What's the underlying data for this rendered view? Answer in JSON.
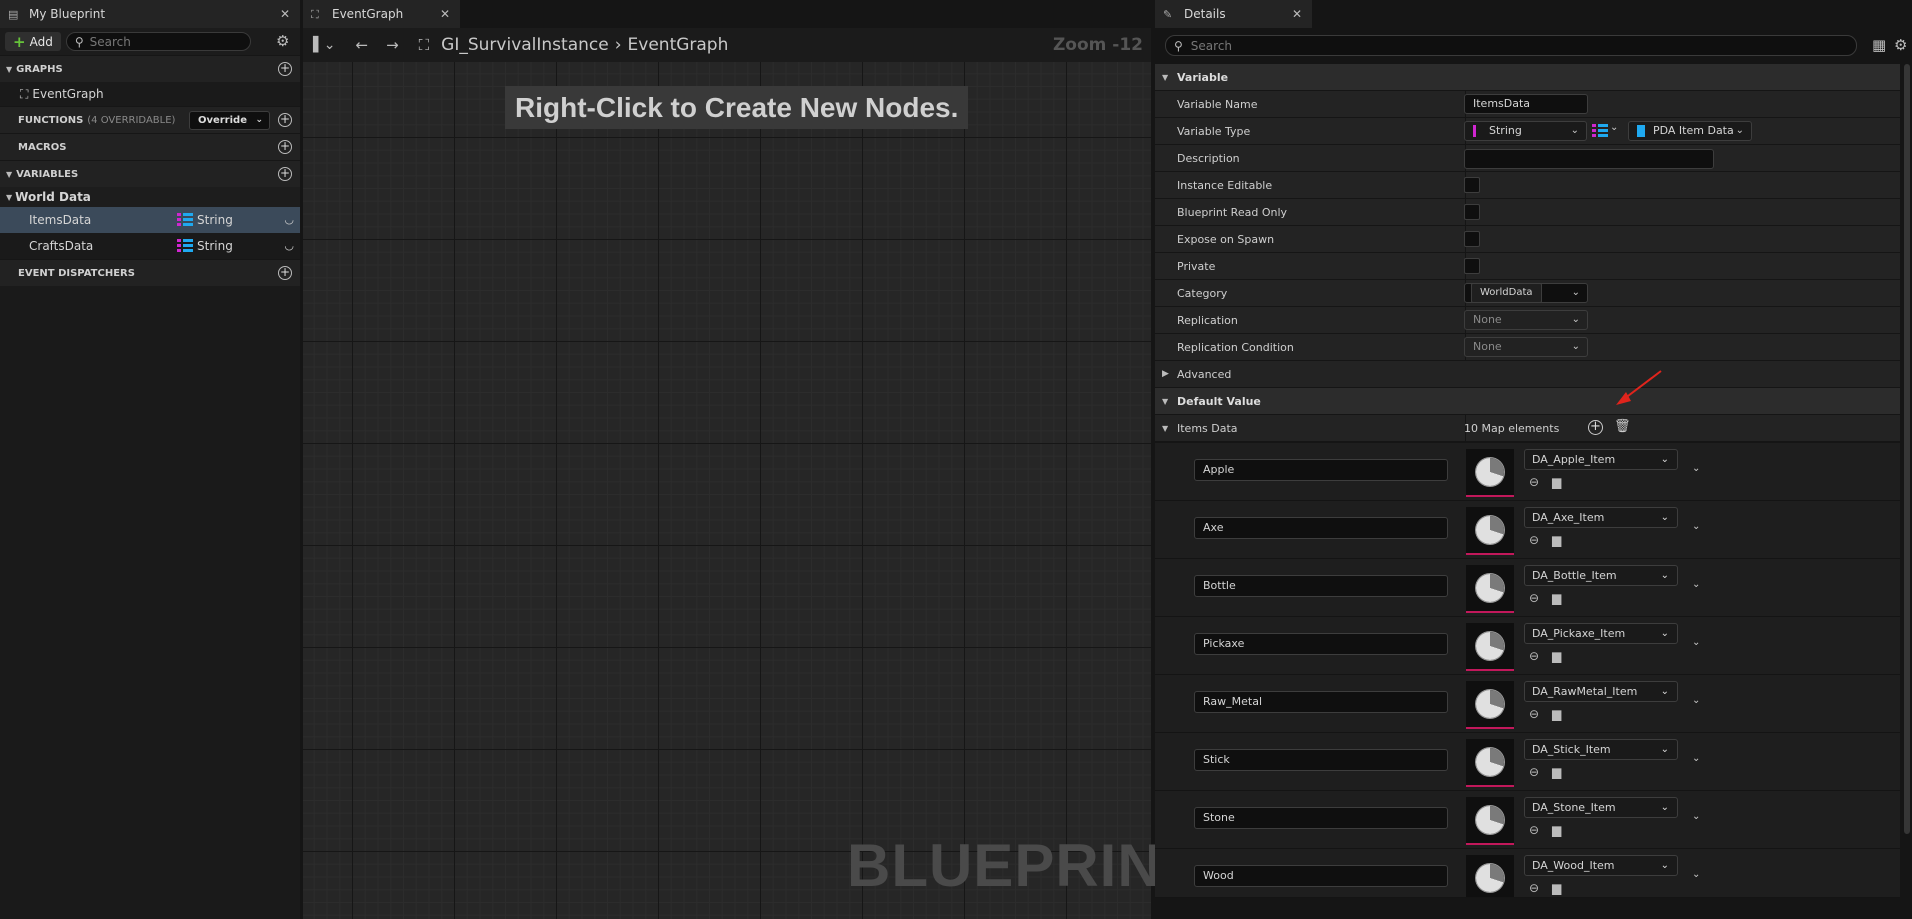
{
  "tabs": {
    "my_blueprint": "My Blueprint",
    "event_graph": "EventGraph",
    "details": "Details"
  },
  "left": {
    "add_label": "Add",
    "search_placeholder": "Search",
    "graphs_header": "GRAPHS",
    "graph_item": "EventGraph",
    "functions_header": "FUNCTIONS",
    "functions_sub": "(4 OVERRIDABLE)",
    "override_label": "Override",
    "macros_header": "MACROS",
    "variables_header": "VARIABLES",
    "category_name": "World Data",
    "variables": [
      {
        "name": "ItemsData",
        "type": "String"
      },
      {
        "name": "CraftsData",
        "type": "String"
      }
    ],
    "dispatchers_header": "EVENT DISPATCHERS"
  },
  "graph": {
    "breadcrumb_root": "GI_SurvivalInstance",
    "breadcrumb_leaf": "EventGraph",
    "zoom": "Zoom -12",
    "hint": "Right-Click to Create New Nodes.",
    "watermark": "BLUEPRINT"
  },
  "details": {
    "search_placeholder": "Search",
    "variable_section": "Variable",
    "props": {
      "variable_name_label": "Variable Name",
      "variable_name_value": "ItemsData",
      "variable_type_label": "Variable Type",
      "key_type": "String",
      "value_type": "PDA Item Data",
      "description_label": "Description",
      "instance_editable_label": "Instance Editable",
      "bp_read_only_label": "Blueprint Read Only",
      "expose_on_spawn_label": "Expose on Spawn",
      "private_label": "Private",
      "category_label": "Category",
      "category_value": "WorldData",
      "replication_label": "Replication",
      "replication_value": "None",
      "replication_condition_label": "Replication Condition",
      "replication_condition_value": "None",
      "advanced_label": "Advanced"
    },
    "default_value_section": "Default Value",
    "map_label": "Items Data",
    "map_count": "10 Map elements",
    "elements": [
      {
        "key": "Apple",
        "asset": "DA_Apple_Item"
      },
      {
        "key": "Axe",
        "asset": "DA_Axe_Item"
      },
      {
        "key": "Bottle",
        "asset": "DA_Bottle_Item"
      },
      {
        "key": "Pickaxe",
        "asset": "DA_Pickaxe_Item"
      },
      {
        "key": "Raw_Metal",
        "asset": "DA_RawMetal_Item"
      },
      {
        "key": "Stick",
        "asset": "DA_Stick_Item"
      },
      {
        "key": "Stone",
        "asset": "DA_Stone_Item"
      },
      {
        "key": "Wood",
        "asset": "DA_Wood_Item"
      }
    ]
  },
  "colors": {
    "accent_green": "#66c33a",
    "string_pin": "#d026d0",
    "object_pin": "#1fa9f0",
    "asset_underline": "#c2185b",
    "annotation_arrow": "#e0241c"
  }
}
